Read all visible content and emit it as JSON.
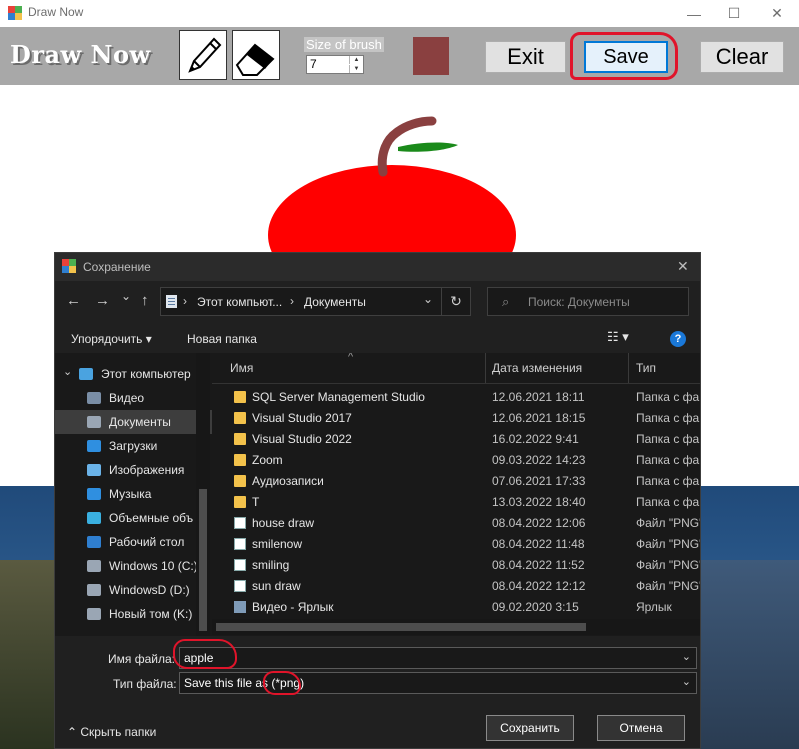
{
  "app": {
    "title": "Draw Now",
    "logo_text": "Draw Now",
    "size_label": "Size of brush",
    "size_value": "7",
    "brush_color": "#8a4040",
    "buttons": {
      "exit": "Exit",
      "save": "Save",
      "clear": "Clear"
    },
    "tools": [
      {
        "name": "pencil-icon"
      },
      {
        "name": "eraser-icon"
      }
    ],
    "window_controls": {
      "minimize": "—",
      "maximize": "☐",
      "close": "✕"
    }
  },
  "drawing": {
    "apple_color": "#ff0000",
    "stem_color": "#8a4040",
    "leaf_color": "#1a8a1a"
  },
  "dialog": {
    "title": "Сохранение",
    "close": "✕",
    "nav": {
      "back": "←",
      "forward": "→",
      "recent": "⌄",
      "up": "↑",
      "refresh": "↻"
    },
    "address": {
      "sep1": "›",
      "part1": "Этот компьют...",
      "sep2": "›",
      "part2": "Документы",
      "dropdown": "⌄"
    },
    "search_placeholder": "Поиск: Документы",
    "search_icon": "⌕",
    "commands": {
      "organize": "Упорядочить ▾",
      "new_folder": "Новая папка",
      "view": "☷ ▾",
      "help": "?"
    },
    "nav_pane": [
      {
        "label": "Этот компьютер",
        "icon": "computer-icon",
        "color": "#4aa3e0",
        "selected": false,
        "expand": "⌄"
      },
      {
        "label": "Видео",
        "icon": "video-icon",
        "color": "#7a8ea6",
        "selected": false
      },
      {
        "label": "Документы",
        "icon": "documents-icon",
        "color": "#9aa6b4",
        "selected": true
      },
      {
        "label": "Загрузки",
        "icon": "downloads-icon",
        "color": "#2f8fe0",
        "selected": false
      },
      {
        "label": "Изображения",
        "icon": "images-icon",
        "color": "#6bb3e8",
        "selected": false
      },
      {
        "label": "Музыка",
        "icon": "music-icon",
        "color": "#2f8fe0",
        "selected": false
      },
      {
        "label": "Объемные объ",
        "icon": "3d-objects-icon",
        "color": "#3ab0e0",
        "selected": false
      },
      {
        "label": "Рабочий стол",
        "icon": "desktop-icon",
        "color": "#2f7fd0",
        "selected": false
      },
      {
        "label": "Windows 10 (C:)",
        "icon": "drive-icon",
        "color": "#9aa6b4",
        "selected": false
      },
      {
        "label": "WindowsD (D:)",
        "icon": "drive-icon",
        "color": "#9aa6b4",
        "selected": false
      },
      {
        "label": "Новый том (K:)",
        "icon": "drive-icon",
        "color": "#9aa6b4",
        "selected": false
      }
    ],
    "columns": {
      "name": "Имя",
      "date": "Дата изменения",
      "type": "Тип",
      "sort_indicator": "^"
    },
    "files": [
      {
        "name": "SQL Server Management Studio",
        "date": "12.06.2021 18:11",
        "type": "Папка с фай",
        "kind": "folder"
      },
      {
        "name": "Visual Studio 2017",
        "date": "12.06.2021 18:15",
        "type": "Папка с фай",
        "kind": "folder"
      },
      {
        "name": "Visual Studio 2022",
        "date": "16.02.2022 9:41",
        "type": "Папка с фай",
        "kind": "folder"
      },
      {
        "name": "Zoom",
        "date": "09.03.2022 14:23",
        "type": "Папка с фай",
        "kind": "folder"
      },
      {
        "name": "Аудиозаписи",
        "date": "07.06.2021 17:33",
        "type": "Папка с фай",
        "kind": "folder"
      },
      {
        "name": "T",
        "date": "13.03.2022 18:40",
        "type": "Папка с фай",
        "kind": "folder"
      },
      {
        "name": "house draw",
        "date": "08.04.2022 12:06",
        "type": "Файл \"PNG\"",
        "kind": "png"
      },
      {
        "name": "smilenow",
        "date": "08.04.2022 11:48",
        "type": "Файл \"PNG\"",
        "kind": "png"
      },
      {
        "name": "smiling",
        "date": "08.04.2022 11:52",
        "type": "Файл \"PNG\"",
        "kind": "png"
      },
      {
        "name": "sun draw",
        "date": "08.04.2022 12:12",
        "type": "Файл \"PNG\"",
        "kind": "png"
      },
      {
        "name": "Видео - Ярлык",
        "date": "09.02.2020 3:15",
        "type": "Ярлык",
        "kind": "shortcut"
      }
    ],
    "filename_label": "Имя файла:",
    "filename_value": "apple",
    "filetype_label": "Тип файла:",
    "filetype_value": "Save this file as (*png)",
    "combo_arrow": "⌄",
    "hide_folders": "⌃  Скрыть папки",
    "save_button": "Сохранить",
    "cancel_button": "Отмена"
  }
}
